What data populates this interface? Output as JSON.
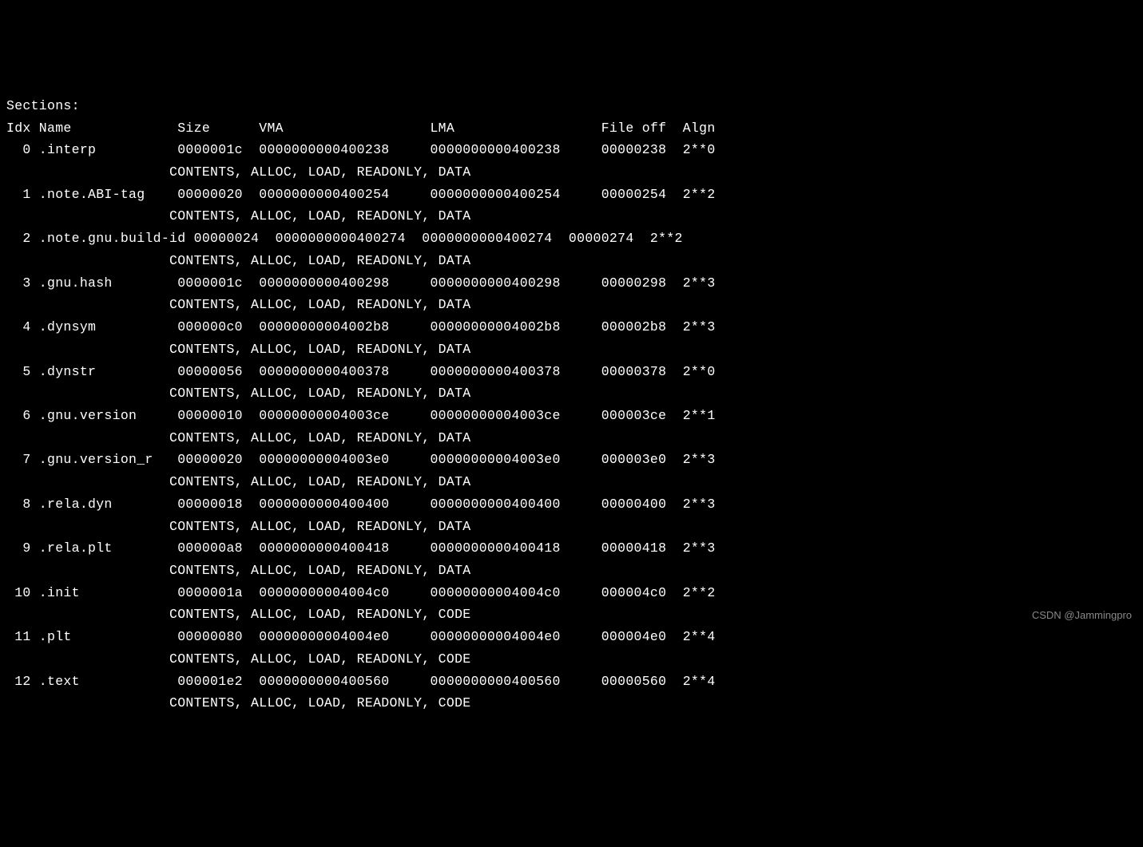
{
  "title": "Sections:",
  "header": {
    "idx": "Idx",
    "name": "Name",
    "size": "Size",
    "vma": "VMA",
    "lma": "LMA",
    "fileoff": "File off",
    "algn": "Algn"
  },
  "sections": [
    {
      "idx": "0",
      "name": ".interp",
      "size": "0000001c",
      "vma": "0000000000400238",
      "lma": "0000000000400238",
      "fileoff": "00000238",
      "algn": "2**0",
      "flags": "CONTENTS, ALLOC, LOAD, READONLY, DATA"
    },
    {
      "idx": "1",
      "name": ".note.ABI-tag",
      "size": "00000020",
      "vma": "0000000000400254",
      "lma": "0000000000400254",
      "fileoff": "00000254",
      "algn": "2**2",
      "flags": "CONTENTS, ALLOC, LOAD, READONLY, DATA"
    },
    {
      "idx": "2",
      "name": ".note.gnu.build-id",
      "size": "00000024",
      "vma": "0000000000400274",
      "lma": "0000000000400274",
      "fileoff": "00000274",
      "algn": "2**2",
      "flags": "CONTENTS, ALLOC, LOAD, READONLY, DATA"
    },
    {
      "idx": "3",
      "name": ".gnu.hash",
      "size": "0000001c",
      "vma": "0000000000400298",
      "lma": "0000000000400298",
      "fileoff": "00000298",
      "algn": "2**3",
      "flags": "CONTENTS, ALLOC, LOAD, READONLY, DATA"
    },
    {
      "idx": "4",
      "name": ".dynsym",
      "size": "000000c0",
      "vma": "00000000004002b8",
      "lma": "00000000004002b8",
      "fileoff": "000002b8",
      "algn": "2**3",
      "flags": "CONTENTS, ALLOC, LOAD, READONLY, DATA"
    },
    {
      "idx": "5",
      "name": ".dynstr",
      "size": "00000056",
      "vma": "0000000000400378",
      "lma": "0000000000400378",
      "fileoff": "00000378",
      "algn": "2**0",
      "flags": "CONTENTS, ALLOC, LOAD, READONLY, DATA"
    },
    {
      "idx": "6",
      "name": ".gnu.version",
      "size": "00000010",
      "vma": "00000000004003ce",
      "lma": "00000000004003ce",
      "fileoff": "000003ce",
      "algn": "2**1",
      "flags": "CONTENTS, ALLOC, LOAD, READONLY, DATA"
    },
    {
      "idx": "7",
      "name": ".gnu.version_r",
      "size": "00000020",
      "vma": "00000000004003e0",
      "lma": "00000000004003e0",
      "fileoff": "000003e0",
      "algn": "2**3",
      "flags": "CONTENTS, ALLOC, LOAD, READONLY, DATA"
    },
    {
      "idx": "8",
      "name": ".rela.dyn",
      "size": "00000018",
      "vma": "0000000000400400",
      "lma": "0000000000400400",
      "fileoff": "00000400",
      "algn": "2**3",
      "flags": "CONTENTS, ALLOC, LOAD, READONLY, DATA"
    },
    {
      "idx": "9",
      "name": ".rela.plt",
      "size": "000000a8",
      "vma": "0000000000400418",
      "lma": "0000000000400418",
      "fileoff": "00000418",
      "algn": "2**3",
      "flags": "CONTENTS, ALLOC, LOAD, READONLY, DATA"
    },
    {
      "idx": "10",
      "name": ".init",
      "size": "0000001a",
      "vma": "00000000004004c0",
      "lma": "00000000004004c0",
      "fileoff": "000004c0",
      "algn": "2**2",
      "flags": "CONTENTS, ALLOC, LOAD, READONLY, CODE"
    },
    {
      "idx": "11",
      "name": ".plt",
      "size": "00000080",
      "vma": "00000000004004e0",
      "lma": "00000000004004e0",
      "fileoff": "000004e0",
      "algn": "2**4",
      "flags": "CONTENTS, ALLOC, LOAD, READONLY, CODE"
    },
    {
      "idx": "12",
      "name": ".text",
      "size": "000001e2",
      "vma": "0000000000400560",
      "lma": "0000000000400560",
      "fileoff": "00000560",
      "algn": "2**4",
      "flags": "CONTENTS, ALLOC, LOAD, READONLY, CODE"
    }
  ],
  "watermark": "CSDN @Jammingpro",
  "columns": {
    "idx": 3,
    "name": 17,
    "size": 10,
    "vma": 21,
    "lma": 21,
    "fileoff": 10,
    "algn": 6,
    "flags_indent": 20
  }
}
